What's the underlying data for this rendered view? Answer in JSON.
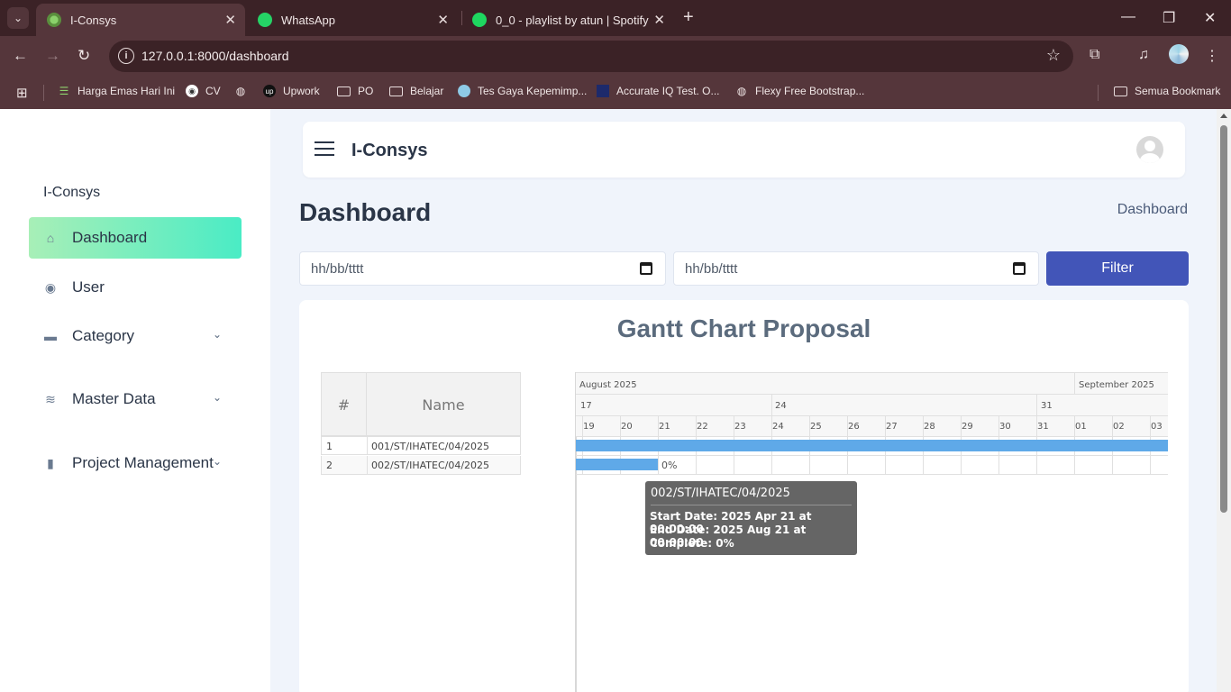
{
  "browser": {
    "tabs": [
      {
        "title": "I-Consys",
        "active": true
      },
      {
        "title": "WhatsApp",
        "active": false
      },
      {
        "title": "0_0 - playlist by atun | Spotify",
        "active": false
      }
    ],
    "url": "127.0.0.1:8000/dashboard",
    "bookmarks": [
      {
        "label": "Harga Emas Hari Ini"
      },
      {
        "label": "CV"
      },
      {
        "label": "Upwork"
      },
      {
        "label": "PO"
      },
      {
        "label": "Belajar"
      },
      {
        "label": "Tes Gaya Kepemimp..."
      },
      {
        "label": "Accurate IQ Test. O..."
      },
      {
        "label": "Flexy Free Bootstrap..."
      },
      {
        "label": "Semua Bookmark"
      }
    ]
  },
  "sidebar": {
    "brand": "I-Consys",
    "items": [
      {
        "label": "Dashboard",
        "icon": "home-icon",
        "active": true
      },
      {
        "label": "User",
        "icon": "user-circle-icon"
      },
      {
        "label": "Category",
        "icon": "briefcase-icon",
        "expandable": true
      },
      {
        "label": "Master Data",
        "icon": "database-icon",
        "expandable": true
      },
      {
        "label": "Project Management",
        "icon": "clipboard-icon",
        "expandable": true
      }
    ]
  },
  "header": {
    "app_title": "I-Consys"
  },
  "main": {
    "page_title": "Dashboard",
    "breadcrumb": "Dashboard",
    "start_date_placeholder": "hh/bb/tttt",
    "end_date_placeholder": "hh/bb/tttt",
    "filter_label": "Filter"
  },
  "gantt": {
    "title": "Gantt Chart Proposal",
    "columns": {
      "number": "#",
      "name": "Name"
    },
    "months": [
      "August 2025",
      "September 2025"
    ],
    "weeks": [
      "17",
      "24",
      "31"
    ],
    "days": [
      "19",
      "20",
      "21",
      "22",
      "23",
      "24",
      "25",
      "26",
      "27",
      "28",
      "29",
      "30",
      "31",
      "01",
      "02",
      "03"
    ],
    "rows": [
      {
        "num": "1",
        "name": "001/ST/IHATEC/04/2025"
      },
      {
        "num": "2",
        "name": "002/ST/IHATEC/04/2025",
        "percent_label": "0%"
      }
    ],
    "tooltip": {
      "title": "002/ST/IHATEC/04/2025",
      "start": "Start Date: 2025 Apr 21 at 00:00:00",
      "end": "End Date: 2025 Aug 21 at 00:00:00",
      "complete": "Complete: 0%"
    }
  },
  "colors": {
    "primary": "#4255b8",
    "active_gradient_start": "#a8efb7",
    "active_gradient_end": "#4aecc5",
    "bar": "#5fa9e8",
    "text_dark": "#2a3547"
  }
}
